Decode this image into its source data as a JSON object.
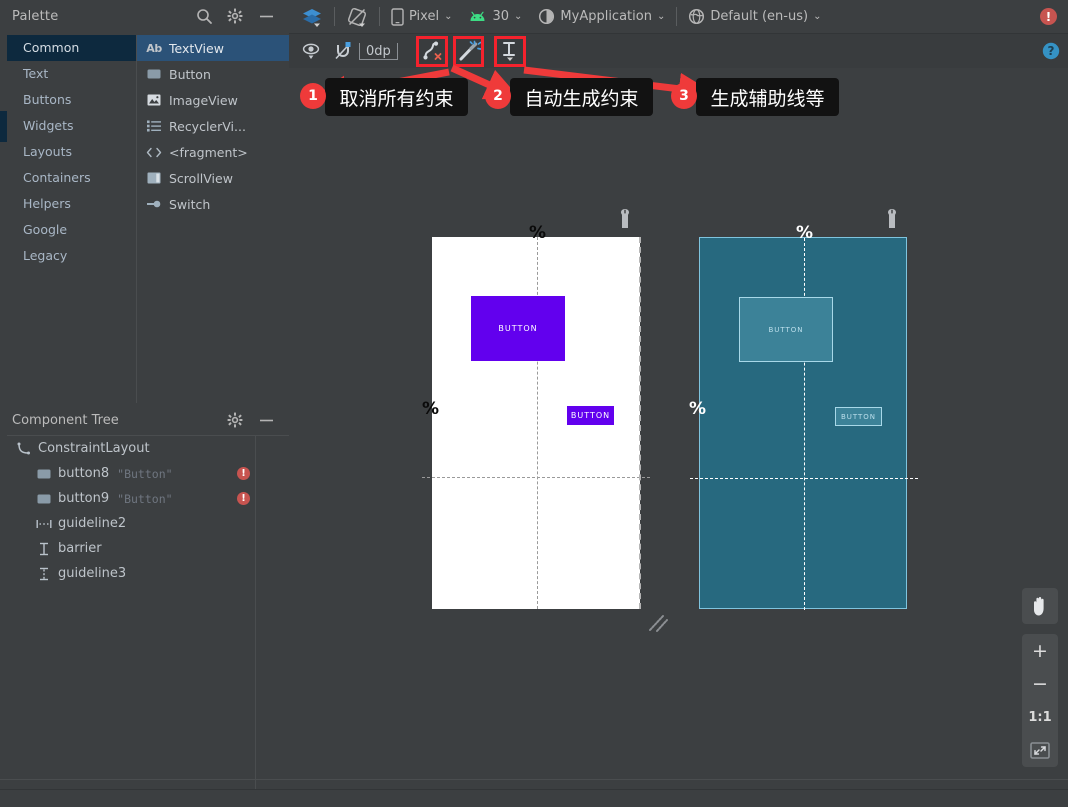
{
  "palette": {
    "title": "Palette",
    "icons": {
      "search": "search-icon",
      "settings": "gear-icon",
      "minimize": "minimize-icon"
    },
    "categories": [
      {
        "label": "Common",
        "selected": true
      },
      {
        "label": "Text",
        "selected": false
      },
      {
        "label": "Buttons",
        "selected": false
      },
      {
        "label": "Widgets",
        "selected": false
      },
      {
        "label": "Layouts",
        "selected": false
      },
      {
        "label": "Containers",
        "selected": false
      },
      {
        "label": "Helpers",
        "selected": false
      },
      {
        "label": "Google",
        "selected": false
      },
      {
        "label": "Legacy",
        "selected": false
      }
    ],
    "items": [
      {
        "label": "TextView",
        "icon": "ab-text-icon",
        "selected": true
      },
      {
        "label": "Button",
        "icon": "button-icon",
        "selected": false
      },
      {
        "label": "ImageView",
        "icon": "image-icon",
        "selected": false
      },
      {
        "label": "RecyclerVi...",
        "icon": "list-icon",
        "selected": false
      },
      {
        "label": "<fragment>",
        "icon": "code-brackets-icon",
        "selected": false
      },
      {
        "label": "ScrollView",
        "icon": "scrollview-icon",
        "selected": false
      },
      {
        "label": "Switch",
        "icon": "switch-icon",
        "selected": false
      }
    ]
  },
  "component_tree": {
    "title": "Component Tree",
    "icons": {
      "settings": "gear-icon",
      "minimize": "minimize-icon"
    },
    "nodes": [
      {
        "label": "ConstraintLayout",
        "sub": "",
        "icon": "constraintlayout-icon",
        "level": 0,
        "error": false
      },
      {
        "label": "button8",
        "sub": "\"Button\"",
        "icon": "button-icon",
        "level": 1,
        "error": true
      },
      {
        "label": "button9",
        "sub": "\"Button\"",
        "icon": "button-icon",
        "level": 1,
        "error": true
      },
      {
        "label": "guideline2",
        "sub": "",
        "icon": "guideline-vertical-icon",
        "level": 1,
        "error": false
      },
      {
        "label": "barrier",
        "sub": "",
        "icon": "barrier-icon",
        "level": 1,
        "error": false
      },
      {
        "label": "guideline3",
        "sub": "",
        "icon": "guideline-horizontal-icon",
        "level": 1,
        "error": false
      }
    ],
    "error_glyph": "!"
  },
  "toolbar": {
    "layers_icon": "layers-icon",
    "orientation_icon": "rotate-device-icon",
    "device": {
      "label": "Pixel",
      "icon": "phone-icon",
      "caret": "⌄"
    },
    "api": {
      "label": "30",
      "icon": "android-icon",
      "caret": "⌄"
    },
    "theme": {
      "label": "MyApplication",
      "icon": "theme-contrast-icon",
      "caret": "⌄"
    },
    "locale": {
      "label": "Default (en-us)",
      "icon": "globe-icon",
      "caret": "⌄"
    },
    "error_badge": "!"
  },
  "constraint_toolbar": {
    "view_options_icon": "eye-icon",
    "autoconnect_icon": "magnet-off-icon",
    "margin_value": "0dp",
    "clear_constraints_icon": "clear-constraints-icon",
    "infer_constraints_icon": "magic-wand-icon",
    "guidelines_icon": "guidelines-icon",
    "help_icon": "help-icon",
    "highlight_color": "#f5222d"
  },
  "annotations": [
    {
      "number": "1",
      "text": "取消所有约束"
    },
    {
      "number": "2",
      "text": "自动生成约束"
    },
    {
      "number": "3",
      "text": "生成辅助线等"
    }
  ],
  "canvas": {
    "design_view": {
      "name": "design-surface",
      "background": "#ffffff",
      "widgets": [
        {
          "label": "BUTTON",
          "name": "button8-design"
        },
        {
          "label": "BUTTON",
          "name": "button9-design"
        }
      ],
      "guideline_marks": [
        "%",
        "%"
      ],
      "wrench_icon": "wrench-icon"
    },
    "blueprint_view": {
      "name": "blueprint-surface",
      "background": "#27697f",
      "widgets": [
        {
          "label": "BUTTON",
          "name": "button8-blueprint"
        },
        {
          "label": "BUTTON",
          "name": "button9-blueprint"
        }
      ],
      "guideline_marks": [
        "%",
        "%"
      ],
      "wrench_icon": "wrench-icon"
    },
    "resize_handle": "resize-handle-icon"
  },
  "zoom_controls": {
    "pan_icon": "pan-hand-icon",
    "zoom_in": "+",
    "zoom_out": "−",
    "actual_size": "1:1",
    "zoom_to_fit_icon": "zoom-to-fit-icon"
  }
}
